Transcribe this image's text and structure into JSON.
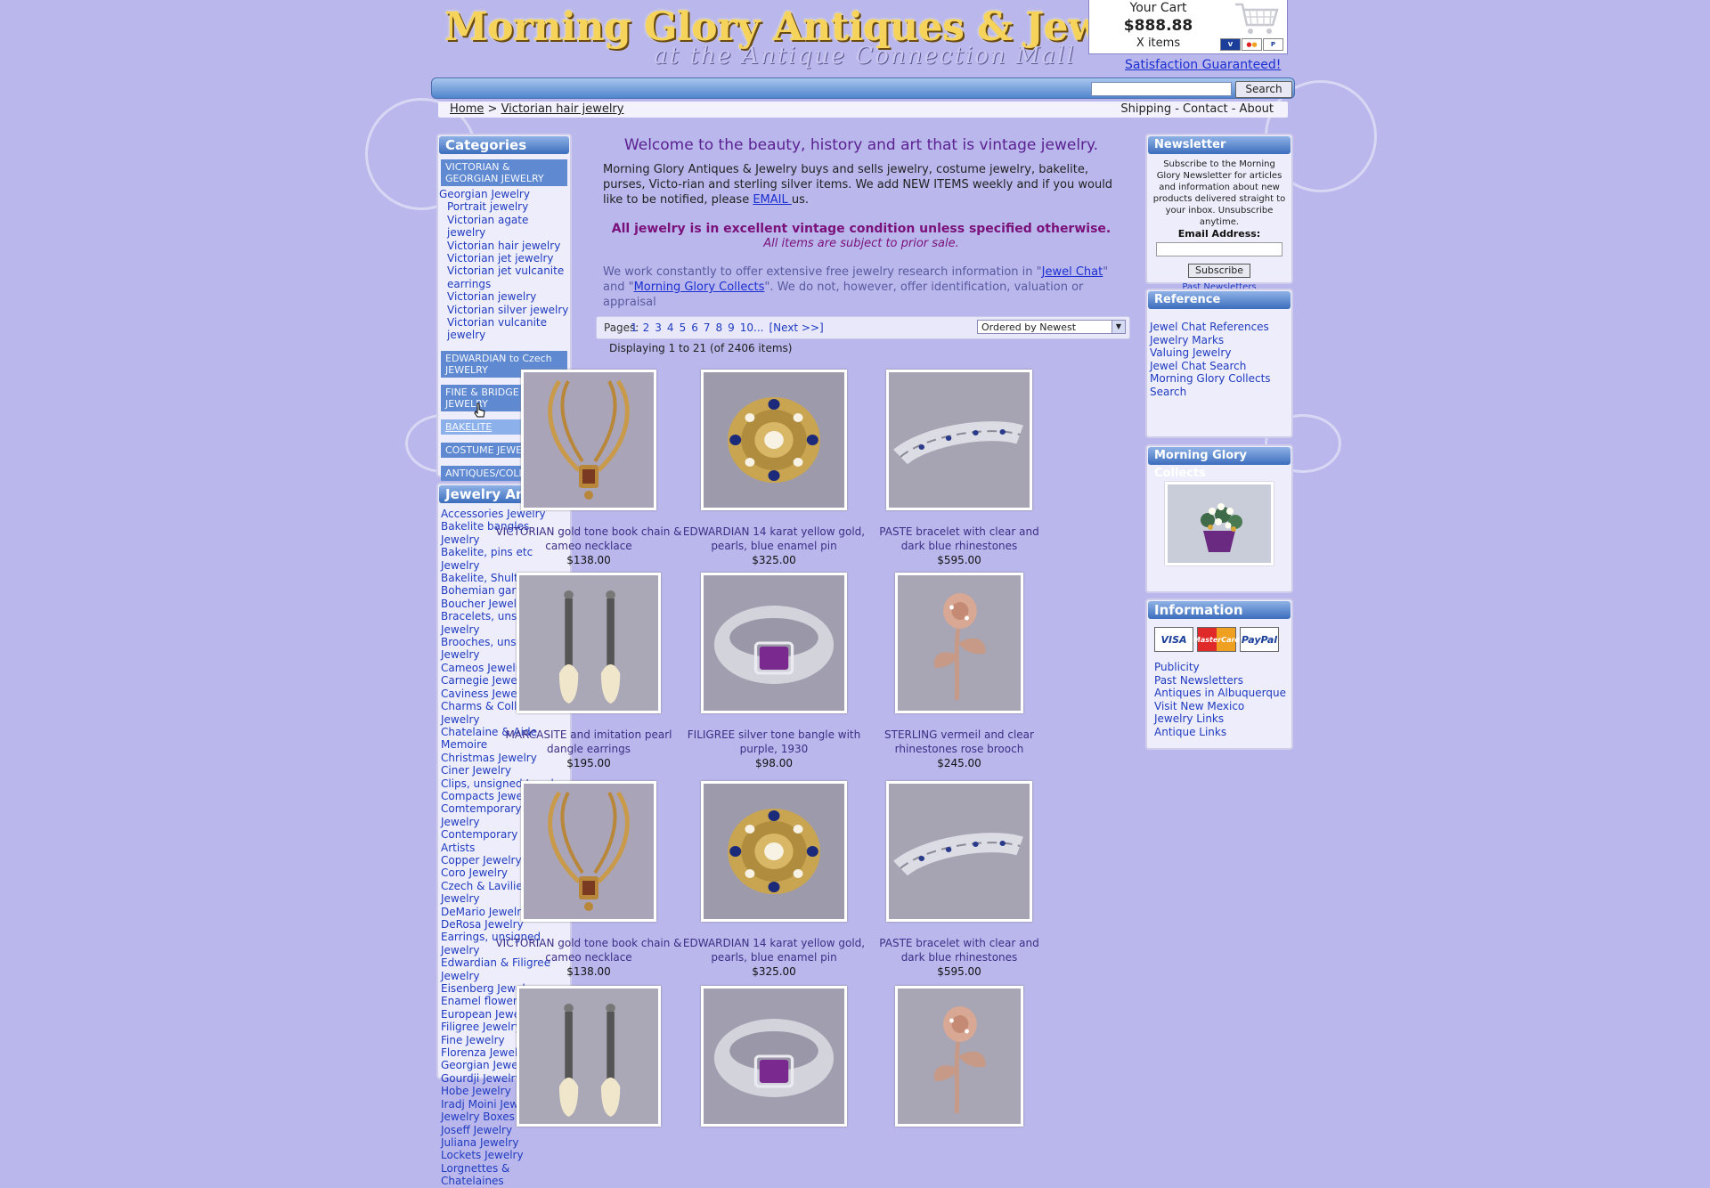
{
  "header": {
    "title": "Morning Glory Antiques & Jewelry",
    "subtitle": "at the Antique Connection Mall",
    "cart": {
      "title": "Your Cart",
      "total": "$888.88",
      "items": "X items"
    },
    "satisfaction": "Satisfaction Guaranteed!",
    "search_button": "Search"
  },
  "breadcrumb": {
    "home": "Home",
    "sep": ">",
    "current": "Victorian hair jewelry"
  },
  "toplinks": "Shipping - Contact - About",
  "categories": {
    "title": "Categories",
    "victorian_header": "VICTORIAN & GEORGIAN JEWELRY",
    "victorian_links": [
      "Georgian Jewelry",
      "Portrait jewelry",
      "Victorian agate jewelry",
      "Victorian hair jewelry",
      "Victorian jet jewelry",
      "Victorian jet vulcanite earrings",
      "Victorian jewelry",
      "Victorian silver jewelry",
      "Victorian vulcanite jewelry"
    ],
    "sections": [
      "EDWARDIAN to Czech JEWELRY",
      "FINE & BRIDGE JEWELRY",
      "BAKELITE",
      "COSTUME JEWELRY",
      "ANTIQUES/COLLECTIBLES"
    ]
  },
  "articles": {
    "title": "Jewelry Articles",
    "links": [
      "Accessories Jewelry",
      "Bakelite bangles Jewelry",
      "Bakelite, pins etc Jewelry",
      "Bakelite, Shultz Jewelry",
      "Bohemian garnets",
      "Boucher Jewelry",
      "Bracelets, unsigned Jewelry",
      "Brooches, unsigned Jewelry",
      "Cameos Jewelry",
      "Carnegie Jewelry",
      "Caviness Jewelry",
      "Charms & Collection Jewelry",
      "Chatelaine & Aide Memoire",
      "Christmas Jewelry",
      "Ciner Jewelry",
      "Clips, unsigned Jewelry",
      "Compacts Jewelry",
      "Comtemporary Bakelite Jewelry",
      "Contemporary Bakelite Artists",
      "Copper Jewelry",
      "Coro Jewelry",
      "Czech & Lavilieres Jewelry",
      "DeMario Jewelry",
      "DeRosa Jewelry",
      "Earrings, unsigned Jewelry",
      "Edwardian & Filigree Jewelry",
      "Eisenberg Jewelry",
      "Enamel flower pins",
      "European Jewelry",
      "Filigree Jewelry",
      "Fine Jewelry",
      "Florenza Jewelry",
      "Georgian Jewelry",
      "Gourdji Jewelry",
      "Hobe Jewelry",
      "Iradj Moini Jewelry",
      "Jewelry Boxes",
      "Joseff Jewelry",
      "Juliana Jewelry",
      "Lockets Jewelry",
      "Lorgnettes & Chatelaines"
    ]
  },
  "main": {
    "welcome": "Welcome to the beauty, history and art that is vintage jewelry.",
    "intro_before": "Morning Glory Antiques & Jewelry buys and sells jewelry, costume jewelry, bakelite, purses, Victo-rian and sterling silver items. We add NEW ITEMS weekly and if you would like to be notified, please ",
    "intro_link": "EMAIL ",
    "intro_after": "us.",
    "condition": "All jewelry is in excellent vintage condition unless specified otherwise.",
    "prior_sale": "All items are subject to prior sale.",
    "research_1": "We work constantly to offer extensive free jewelry research information in \"",
    "research_link1": "Jewel Chat",
    "research_2": "\" and \"",
    "research_link2": "Morning Glory Collects",
    "research_3": "\".  We do not, however, offer identification, valuation or appraisal",
    "pager_label": "Pages:",
    "pages": [
      "1",
      "2",
      "3",
      "4",
      "5",
      "6",
      "7",
      "8",
      "9",
      "10...",
      "[Next >>]"
    ],
    "sort": "Ordered by Newest",
    "display_count": "Displaying 1 to 21 (of 2406 items)"
  },
  "products": [
    {
      "title": "VICTORIAN gold tone book chain & cameo necklace",
      "price": "$138.00",
      "image": "necklace"
    },
    {
      "title": "EDWARDIAN 14 karat yellow gold, pearls, blue enamel pin",
      "price": "$325.00",
      "image": "brooch"
    },
    {
      "title": "PASTE bracelet with clear and dark blue rhinestones",
      "price": "$595.00",
      "image": "bracelet"
    },
    {
      "title": "MARCASITE and imitation pearl dangle earrings",
      "price": "$195.00",
      "image": "earrings"
    },
    {
      "title": "FILIGREE silver tone bangle with purple, 1930",
      "price": "$98.00",
      "image": "bangle"
    },
    {
      "title": "STERLING vermeil and clear rhinestones rose brooch",
      "price": "$245.00",
      "image": "rose"
    },
    {
      "title": "VICTORIAN gold tone book chain & cameo necklace",
      "price": "$138.00",
      "image": "necklace"
    },
    {
      "title": "EDWARDIAN 14 karat yellow gold, pearls, blue enamel pin",
      "price": "$325.00",
      "image": "brooch"
    },
    {
      "title": "PASTE bracelet with clear and dark blue rhinestones",
      "price": "$595.00",
      "image": "bracelet"
    },
    {
      "title": "",
      "price": "",
      "image": "earrings"
    },
    {
      "title": "",
      "price": "",
      "image": "bangle"
    },
    {
      "title": "",
      "price": "",
      "image": "rose"
    }
  ],
  "newsletter": {
    "title": "Newsletter",
    "text": "Subscribe to the Morning Glory Newsletter for articles and information about new products delivered straight to your inbox. Unsubscribe anytime.",
    "email_label": "Email Address:",
    "subscribe": "Subscribe",
    "past": "Past Newsletters"
  },
  "reference": {
    "title": "Reference",
    "links": [
      "Jewel Chat References",
      "Jewelry Marks",
      "Valuing Jewelry",
      "Jewel Chat Search",
      "Morning Glory Collects",
      "Search"
    ]
  },
  "mgc": {
    "title": "Morning Glory Collects"
  },
  "information": {
    "title": "Information",
    "cards": [
      "VISA",
      "MasterCard",
      "PayPal"
    ],
    "links": [
      "Publicity",
      "Past Newsletters",
      "Antiques in Albuquerque",
      "Visit New Mexico",
      "Jewelry Links",
      "Antique Links"
    ]
  },
  "colors": {
    "background": "#b9b7ec",
    "panel": "#eeedfb",
    "header_blue": "#3c6dbd",
    "link": "#1f3bbf",
    "accent_purple": "#7a117a"
  }
}
